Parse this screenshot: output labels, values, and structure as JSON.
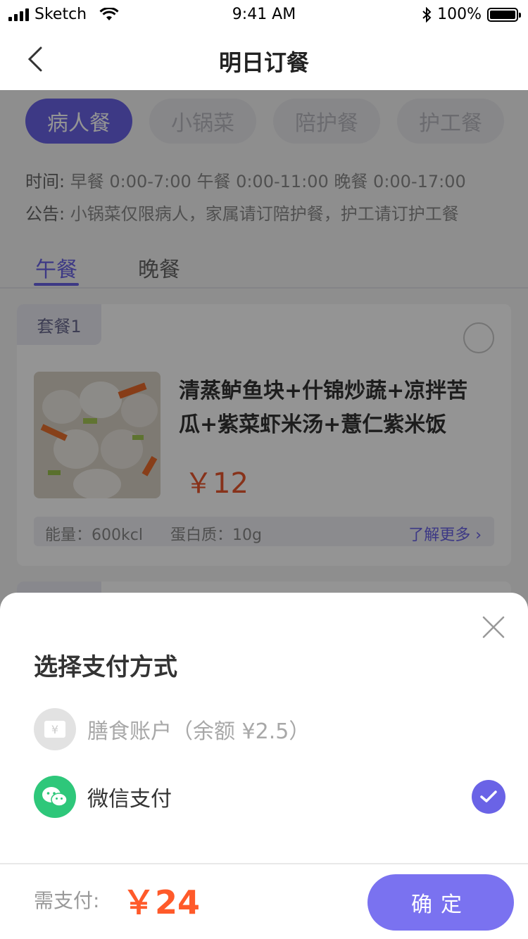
{
  "status_bar": {
    "carrier": "Sketch",
    "time": "9:41 AM",
    "battery": "100%"
  },
  "nav": {
    "title": "明日订餐"
  },
  "categories": [
    {
      "label": "病人餐",
      "active": true
    },
    {
      "label": "小锅菜",
      "active": false
    },
    {
      "label": "陪护餐",
      "active": false
    },
    {
      "label": "护工餐",
      "active": false
    }
  ],
  "time_info": {
    "label": "时间:",
    "text": "早餐 0:00-7:00   午餐 0:00-11:00   晚餐 0:00-17:00"
  },
  "notice": {
    "label": "公告:",
    "text": "小锅菜仅限病人，家属请订陪护餐，护工请订护工餐"
  },
  "meal_tabs": [
    {
      "label": "午餐",
      "active": true
    },
    {
      "label": "晚餐",
      "active": false
    }
  ],
  "meal_card": {
    "tag": "套餐1",
    "name": "清蒸鲈鱼块+什锦炒蔬+凉拌苦瓜+紫菜虾米汤+薏仁紫米饭",
    "price": "￥12",
    "energy": "能量：600kcl",
    "protein": "蛋白质：10g",
    "more": "了解更多 ›"
  },
  "payment_sheet": {
    "title": "选择支付方式",
    "options": [
      {
        "label": "膳食账户（余额 ¥2.5）",
        "icon": "yen-card-icon",
        "disabled": true
      },
      {
        "label": "微信支付",
        "icon": "wechat-icon",
        "selected": true
      }
    ],
    "need_pay_label": "需支付:",
    "total": "￥24",
    "confirm_label": "确定"
  },
  "colors": {
    "accent": "#6a63e6",
    "price": "#ff5a2a",
    "wechat": "#2ec77a"
  }
}
